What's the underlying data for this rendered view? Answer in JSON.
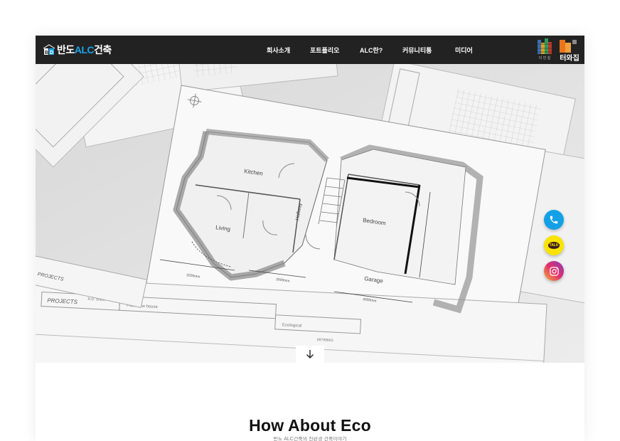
{
  "header": {
    "logo": {
      "prefix": "반도",
      "accent": "ALC",
      "suffix": "건축"
    },
    "nav": [
      {
        "label": "회사소개"
      },
      {
        "label": "포트폴리오"
      },
      {
        "label": "ALC란?"
      },
      {
        "label": "커뮤니티통"
      },
      {
        "label": "미디어"
      }
    ],
    "badges": {
      "left_caption": "더 빈 쉼",
      "right_caption": "터와집"
    }
  },
  "hero": {
    "plan_labels": {
      "kitchen": "Kitchen",
      "living": "Living",
      "hallway": "Hallway",
      "bedroom": "Bedroom",
      "garage": "Garage",
      "dim_a": "3200mm",
      "dim_b": "2600mm",
      "dim_c": "4000mm",
      "projects_a": "PROJECTS",
      "projects_b": "PROJECTS",
      "designer": "R.D. Smith",
      "sheet_title": "Plan view house",
      "ecological": "Ecological",
      "number": "8979966S"
    }
  },
  "floating": {
    "icons": [
      "phone-icon",
      "kakao-talk-icon",
      "instagram-icon"
    ],
    "kakao_text": "TALK"
  },
  "scroll": {
    "icon": "arrow-down-icon"
  },
  "section": {
    "title": "How About Eco",
    "subtitle": "반도 ALC건축의 친환경 건축이야기"
  },
  "colors": {
    "topbar": "#222222",
    "accent": "#1aa3e8",
    "phone": "#14a0e6",
    "kakao": "#fbe300"
  }
}
